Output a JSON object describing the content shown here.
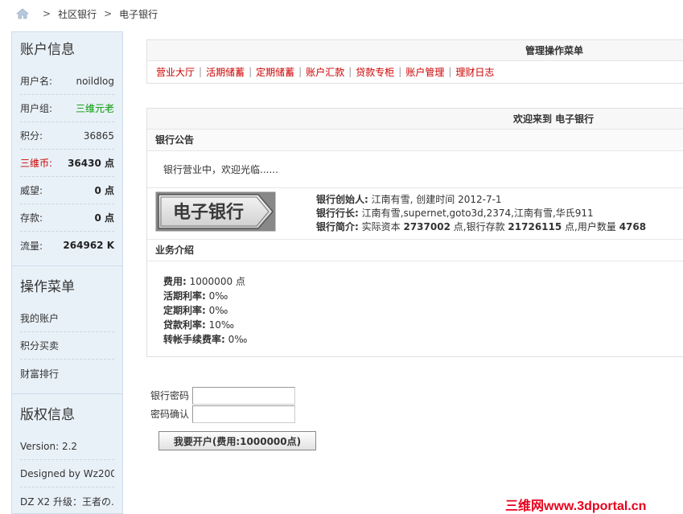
{
  "breadcrumb": {
    "items": [
      "社区银行",
      "电子银行"
    ],
    "separator": ">"
  },
  "sidebar": {
    "account": {
      "title": "账户信息",
      "rows": [
        {
          "label": "用户名:",
          "value": "noildlog"
        },
        {
          "label": "用户组:",
          "value": "三维元老"
        },
        {
          "label": "积分:",
          "value": "36865"
        },
        {
          "label": "三维币:",
          "value": "36430 点"
        },
        {
          "label": "威望:",
          "value": "0 点"
        },
        {
          "label": "存款:",
          "value": "0 点"
        },
        {
          "label": "流量:",
          "value": "264962 K"
        }
      ]
    },
    "ops": {
      "title": "操作菜单",
      "links": [
        "我的账户",
        "积分买卖",
        "财富排行"
      ]
    },
    "copyright": {
      "title": "版权信息",
      "lines": [
        "Version: 2.2",
        "Designed by Wz200...",
        "DZ X2 升级：王者の..."
      ]
    }
  },
  "menu_panel": {
    "title": "管理操作菜单",
    "links": [
      "营业大厅",
      "活期储蓄",
      "定期储蓄",
      "账户汇款",
      "贷款专柜",
      "账户管理",
      "理财日志"
    ],
    "separator": "|"
  },
  "welcome_panel": {
    "title": "欢迎来到 电子银行",
    "notice_title": "银行公告",
    "notice_text": "银行营业中，欢迎光临......",
    "logo_text": "电子银行",
    "founder_label": "银行创始人:",
    "founder_value": "江南有雪, 创建时间 2012-7-1",
    "president_label": "银行行长:",
    "president_value": "江南有雪,supernet,goto3d,2374,江南有雪,华氏911",
    "intro_label": "银行简介:",
    "intro_capital_pre": "实际资本",
    "intro_capital": "2737002",
    "intro_deposit_pre": "点,银行存款",
    "intro_deposit": "21726115",
    "intro_users_pre": "点,用户数量",
    "intro_users": "4768",
    "biz_title": "业务介绍",
    "biz": [
      {
        "label": "费用:",
        "value": "1000000 点"
      },
      {
        "label": "活期利率:",
        "value": "0‰"
      },
      {
        "label": "定期利率:",
        "value": "0‰"
      },
      {
        "label": "贷款利率:",
        "value": "10‰"
      },
      {
        "label": "转帐手续费率:",
        "value": "0‰"
      }
    ]
  },
  "form": {
    "password_label": "银行密码",
    "confirm_label": "密码确认",
    "password_value": "",
    "confirm_value": "",
    "submit_label": "我要开户(费用:1000000点)"
  },
  "watermark": "三维网www.3dportal.cn",
  "colors": {
    "link_red": "#cc0000",
    "group_green": "#009900",
    "sidebar_bg": "#e9f1f8"
  }
}
